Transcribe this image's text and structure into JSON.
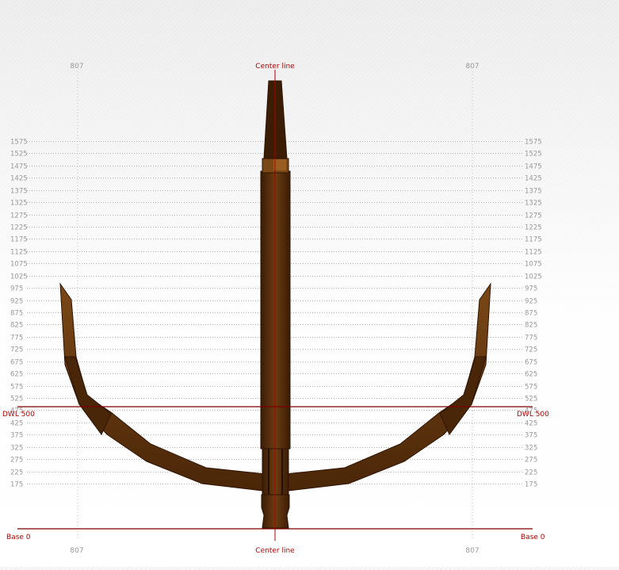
{
  "labels": {
    "center_line": "Center line",
    "dwl": "DWL 500",
    "base": "Base 0",
    "side_offset": "807"
  },
  "scale": {
    "ticks": [
      1575,
      1525,
      1475,
      1425,
      1375,
      1325,
      1275,
      1225,
      1175,
      1125,
      1075,
      1025,
      975,
      925,
      875,
      825,
      775,
      725,
      675,
      625,
      575,
      525,
      475,
      425,
      375,
      325,
      275,
      225,
      175
    ]
  },
  "colors": {
    "accent_red": "#b00000",
    "grid": "#b8b8b8",
    "tick_text": "#999999",
    "waterline": "#7a0000",
    "anchor_dark": "#3b1c05",
    "anchor_mid": "#6b3d12",
    "anchor_light": "#8a5520"
  }
}
